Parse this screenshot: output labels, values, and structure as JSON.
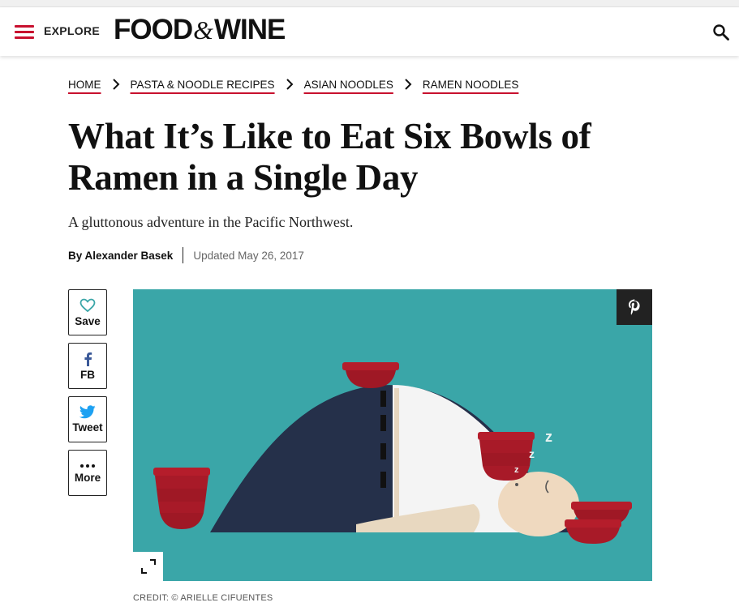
{
  "header": {
    "explore_label": "EXPLORE",
    "logo": {
      "left": "FOOD",
      "amp": "&",
      "right": "WINE"
    }
  },
  "breadcrumb": [
    "HOME",
    "PASTA & NOODLE RECIPES",
    "ASIAN NOODLES",
    "RAMEN NOODLES"
  ],
  "article": {
    "title": "What It’s Like to Eat Six Bowls of Ramen in a Single Day",
    "subtitle": "A gluttonous adventure in the Pacific Northwest.",
    "author": "By Alexander Basek",
    "updated": "Updated May 26, 2017"
  },
  "share": {
    "save": "Save",
    "fb": "FB",
    "tweet": "Tweet",
    "more": "More"
  },
  "image": {
    "credit": "CREDIT: © ARIELLE CIFUENTES"
  },
  "colors": {
    "accent": "#c8102e",
    "image_bg": "#3aa6a8",
    "share_icon": "#1da1f2"
  },
  "icons": {
    "menu": "hamburger-icon",
    "search": "search-icon",
    "save": "heart-icon",
    "fb": "facebook-icon",
    "tweet": "twitter-icon",
    "more": "ellipsis-icon",
    "pin": "pinterest-icon",
    "expand": "expand-icon"
  }
}
